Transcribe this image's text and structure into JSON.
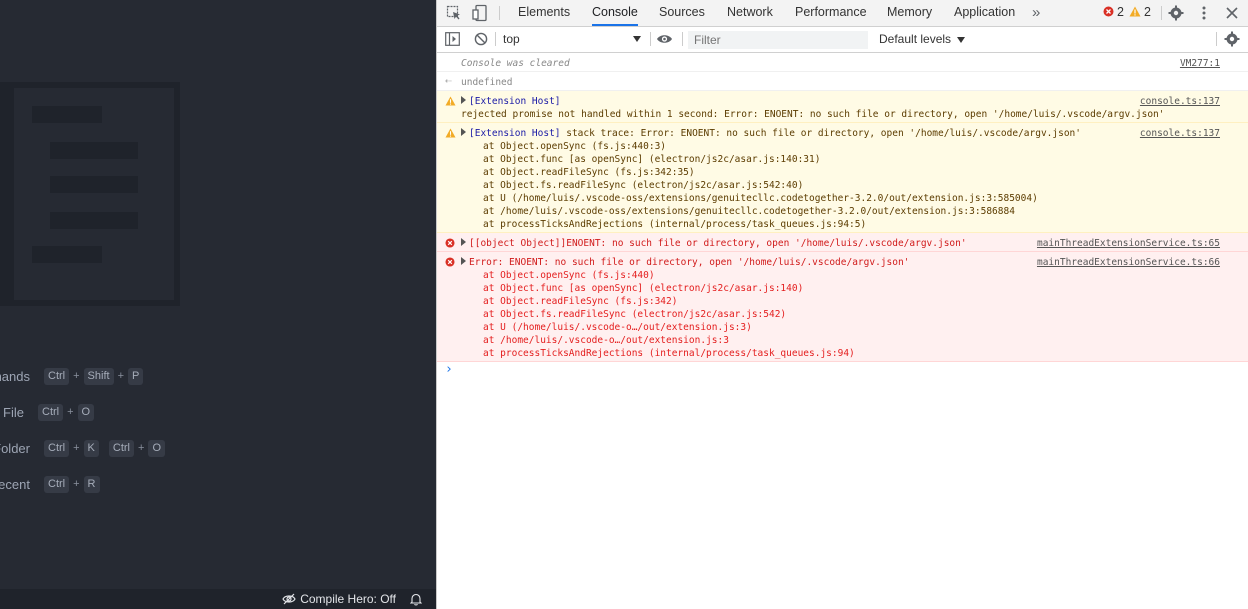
{
  "left_panel": {
    "shortcuts": [
      {
        "label": "mands",
        "keys": [
          [
            "Ctrl",
            "Shift",
            "P"
          ]
        ]
      },
      {
        "label": "en File",
        "keys": [
          [
            "Ctrl",
            "O"
          ]
        ]
      },
      {
        "label": "Folder",
        "keys": [
          [
            "Ctrl",
            "K"
          ],
          [
            "Ctrl",
            "O"
          ]
        ]
      },
      {
        "label": "Recent",
        "keys": [
          [
            "Ctrl",
            "R"
          ]
        ]
      }
    ],
    "status": {
      "compile_hero": "Compile Hero: Off"
    }
  },
  "devtools": {
    "tabs": [
      "Elements",
      "Console",
      "Sources",
      "Network",
      "Performance",
      "Memory",
      "Application"
    ],
    "active_tab": "Console",
    "error_count": "2",
    "warning_count": "2",
    "toolbar": {
      "context": "top",
      "filter_placeholder": "Filter",
      "levels": "Default levels"
    },
    "messages": {
      "cleared": {
        "text": "Console was cleared",
        "src": "VM277:1"
      },
      "undefined": {
        "text": "undefined"
      },
      "warn1": {
        "host": "[Extension Host]",
        "line2": "rejected promise not handled within 1 second: Error: ENOENT: no such file or directory, open '/home/luis/.vscode/argv.json'",
        "src": "console.ts:137"
      },
      "warn2": {
        "host": "[Extension Host]",
        "text": " stack trace: Error: ENOENT: no such file or directory, open '/home/luis/.vscode/argv.json'",
        "src": "console.ts:137",
        "stack": [
          "at Object.openSync (fs.js:440:3)",
          "at Object.func [as openSync] (electron/js2c/asar.js:140:31)",
          "at Object.readFileSync (fs.js:342:35)",
          "at Object.fs.readFileSync (electron/js2c/asar.js:542:40)",
          "at U (/home/luis/.vscode-oss/extensions/genuitecllc.codetogether-3.2.0/out/extension.js:3:585004)",
          "at /home/luis/.vscode-oss/extensions/genuitecllc.codetogether-3.2.0/out/extension.js:3:586884",
          "at processTicksAndRejections (internal/process/task_queues.js:94:5)"
        ]
      },
      "err1": {
        "text": "[[object Object]]ENOENT: no such file or directory, open '/home/luis/.vscode/argv.json'",
        "src": "mainThreadExtensionService.ts:65"
      },
      "err2": {
        "text": "Error: ENOENT: no such file or directory, open '/home/luis/.vscode/argv.json'",
        "src": "mainThreadExtensionService.ts:66",
        "stack": [
          "at Object.openSync (fs.js:440)",
          "at Object.func [as openSync] (electron/js2c/asar.js:140)",
          "at Object.readFileSync (fs.js:342)",
          "at Object.fs.readFileSync (electron/js2c/asar.js:542)",
          "at U (/home/luis/.vscode-o…/out/extension.js:3)",
          "at /home/luis/.vscode-o…/out/extension.js:3",
          "at processTicksAndRejections (internal/process/task_queues.js:94)"
        ]
      }
    }
  },
  "colors": {
    "accent": "#1a73e8",
    "error": "#d93025",
    "warning": "#f2ab26",
    "editor_bg": "#262a33"
  }
}
